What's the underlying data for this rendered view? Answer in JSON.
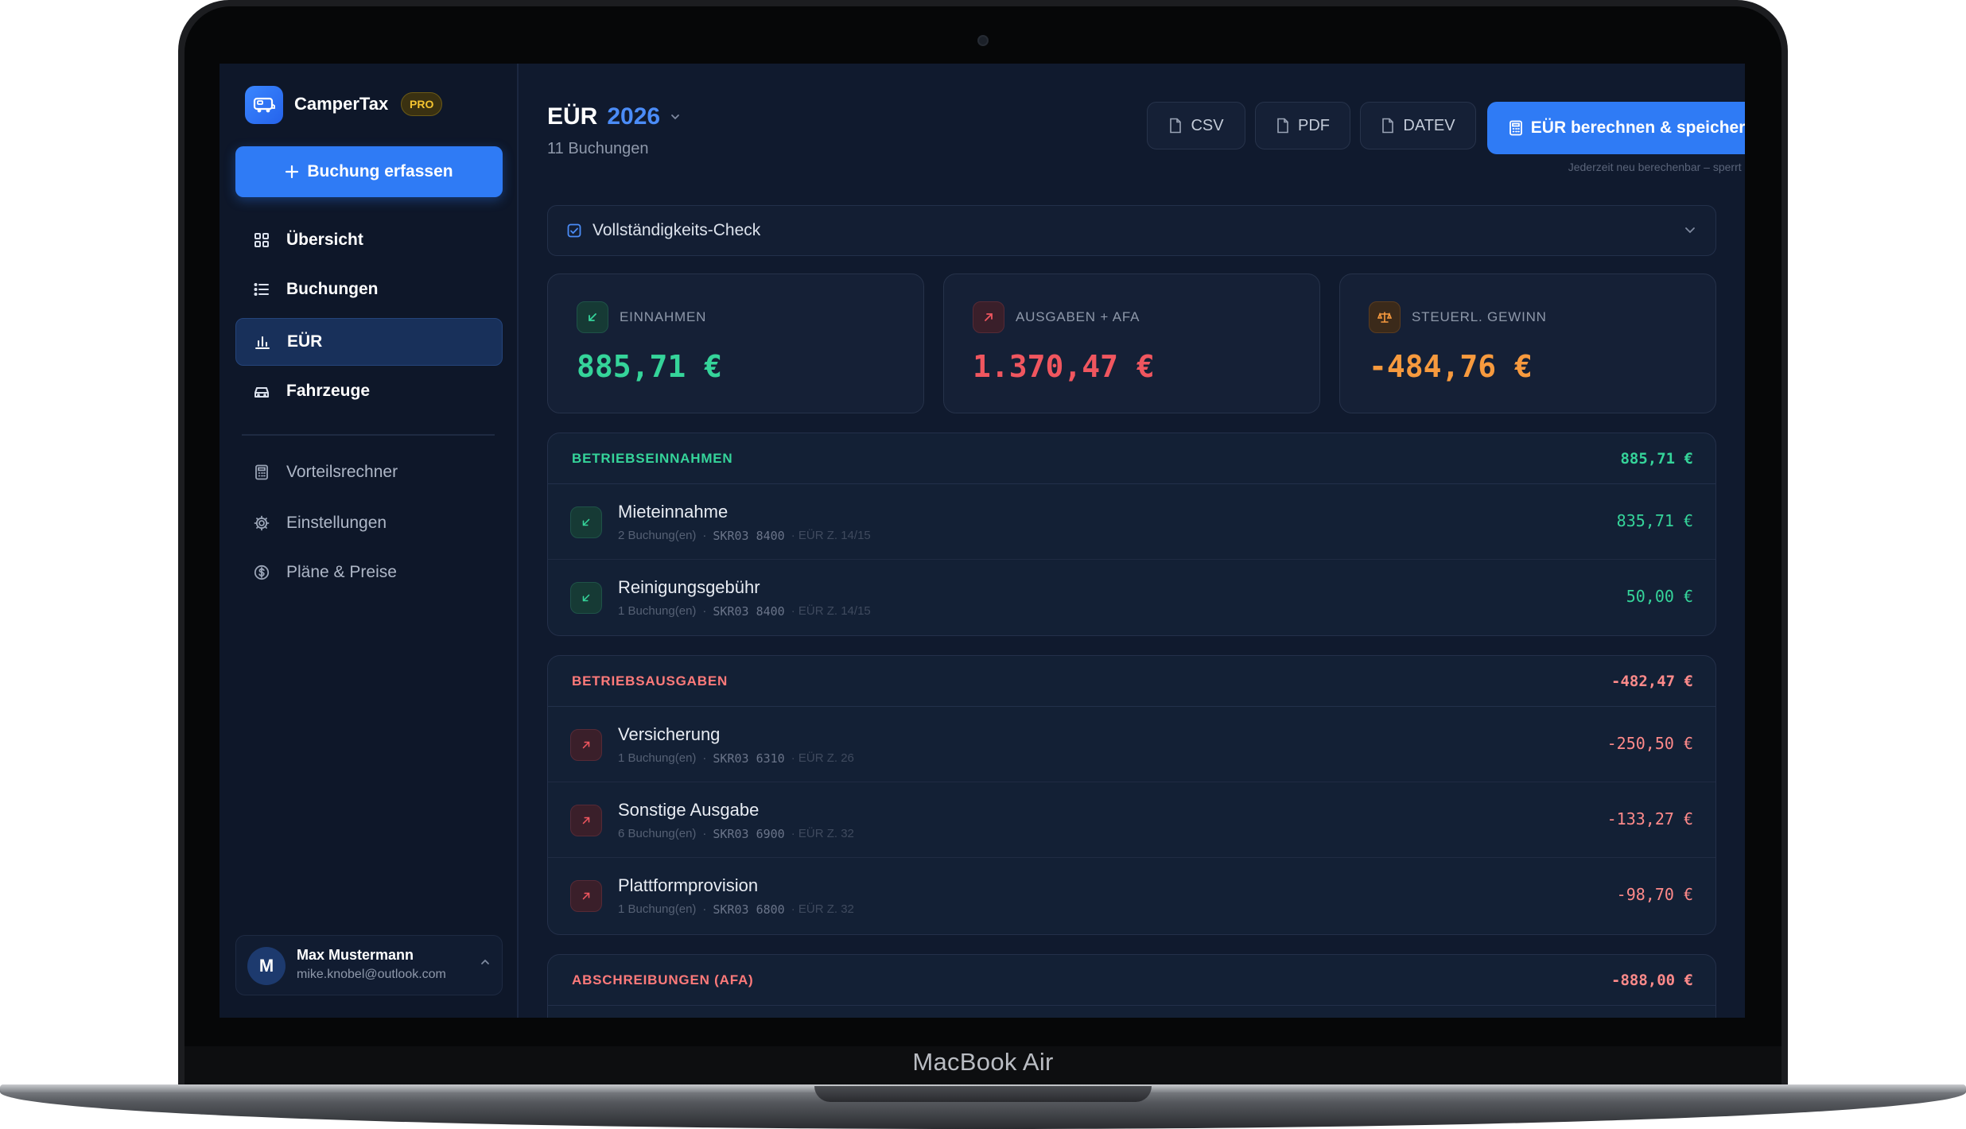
{
  "device": {
    "brand": "MacBook Air"
  },
  "app": {
    "name": "CamperTax",
    "badge": "PRO"
  },
  "sidebar": {
    "primary_action": "Buchung erfassen",
    "items": [
      {
        "label": "Übersicht",
        "icon": "grid-icon"
      },
      {
        "label": "Buchungen",
        "icon": "list-icon"
      },
      {
        "label": "EÜR",
        "icon": "bar-chart-icon",
        "active": true
      },
      {
        "label": "Fahrzeuge",
        "icon": "car-icon"
      }
    ],
    "secondary_items": [
      {
        "label": "Vorteilsrechner",
        "icon": "calculator-icon"
      },
      {
        "label": "Einstellungen",
        "icon": "gear-icon"
      },
      {
        "label": "Pläne & Preise",
        "icon": "dollar-icon"
      }
    ],
    "user": {
      "initial": "M",
      "name": "Max Mustermann",
      "email": "mike.knobel@outlook.com"
    }
  },
  "header": {
    "title": "EÜR",
    "year": "2026",
    "subtitle": "11 Buchungen",
    "export_buttons": [
      "CSV",
      "PDF",
      "DATEV"
    ],
    "calc_button": "EÜR berechnen & speichern",
    "calc_hint": "Jederzeit neu berechenbar – sperrt nichts."
  },
  "check": {
    "label": "Vollständigkeits-Check"
  },
  "kpis": [
    {
      "label": "EINNAHMEN",
      "value": "885,71 €",
      "color": "#35d49a"
    },
    {
      "label": "AUSGABEN + AFA",
      "value": "1.370,47 €",
      "color": "#f0565f"
    },
    {
      "label": "STEUERL. GEWINN",
      "value": "-484,76 €",
      "color": "#f79a3e"
    }
  ],
  "sections": {
    "income": {
      "title": "BETRIEBSEINNAHMEN",
      "total": "885,71 €",
      "rows": [
        {
          "name": "Mieteinnahme",
          "count": "2 Buchung(en)",
          "sep": "·",
          "code": "SKR03 8400",
          "euer": "· EÜR Z. 14/15",
          "amount": "835,71 €"
        },
        {
          "name": "Reinigungsgebühr",
          "count": "1 Buchung(en)",
          "sep": "·",
          "code": "SKR03 8400",
          "euer": "· EÜR Z. 14/15",
          "amount": "50,00 €"
        }
      ]
    },
    "expenses": {
      "title": "BETRIEBSAUSGABEN",
      "total": "-482,47 €",
      "rows": [
        {
          "name": "Versicherung",
          "count": "1 Buchung(en)",
          "sep": "·",
          "code": "SKR03 6310",
          "euer": "· EÜR Z. 26",
          "amount": "-250,50 €"
        },
        {
          "name": "Sonstige Ausgabe",
          "count": "6 Buchung(en)",
          "sep": "·",
          "code": "SKR03 6900",
          "euer": "· EÜR Z. 32",
          "amount": "-133,27 €"
        },
        {
          "name": "Plattformprovision",
          "count": "1 Buchung(en)",
          "sep": "·",
          "code": "SKR03 6800",
          "euer": "· EÜR Z. 32",
          "amount": "-98,70 €"
        }
      ]
    },
    "afa": {
      "title": "ABSCHREIBUNGEN (AFA)",
      "total": "-888,00 €"
    }
  },
  "colors": {
    "accent": "#2f7bf5",
    "income": "#35d49a",
    "expense": "#f0565f",
    "profit": "#f79a3e",
    "expense_text": "#ff8a8a"
  }
}
